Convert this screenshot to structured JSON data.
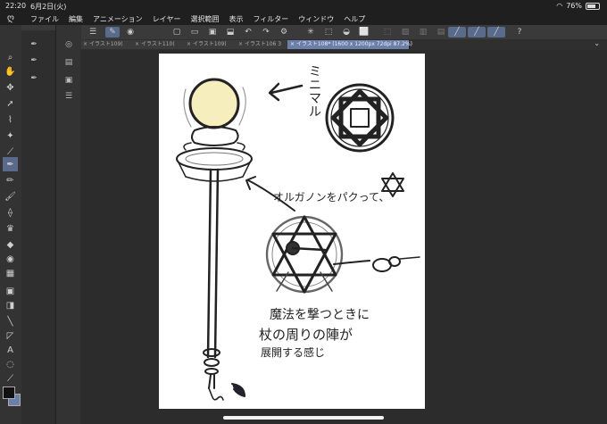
{
  "status": {
    "time": "22:20",
    "date": "6月2日(火)",
    "battery": "76%",
    "battery_level": 0.76
  },
  "menu": [
    "ファイル",
    "編集",
    "アニメーション",
    "レイヤー",
    "選択範囲",
    "表示",
    "フィルター",
    "ウィンドウ",
    "ヘルプ"
  ],
  "tabs": [
    {
      "label": "イラスト109(",
      "active": false
    },
    {
      "label": "イラスト110(",
      "active": false
    },
    {
      "label": "イラスト109(",
      "active": false
    },
    {
      "label": "イラスト106 3",
      "active": false
    },
    {
      "label": "イラスト108* (1600 x 1200px 72dpi 87.2%)",
      "active": true
    }
  ],
  "sketch_text": {
    "note1": "ミニマル",
    "note2": "オルガノンをパクって、",
    "note3_line1": "魔法を撃つときに",
    "note3_line2": "杖の周りの陣が",
    "note3_line3": "展開する感じ"
  },
  "colors": {
    "accent": "#6b7fa8",
    "tool_active": "#5a6a8a",
    "paper": "#ffffff",
    "orb": "#f6eebc"
  }
}
